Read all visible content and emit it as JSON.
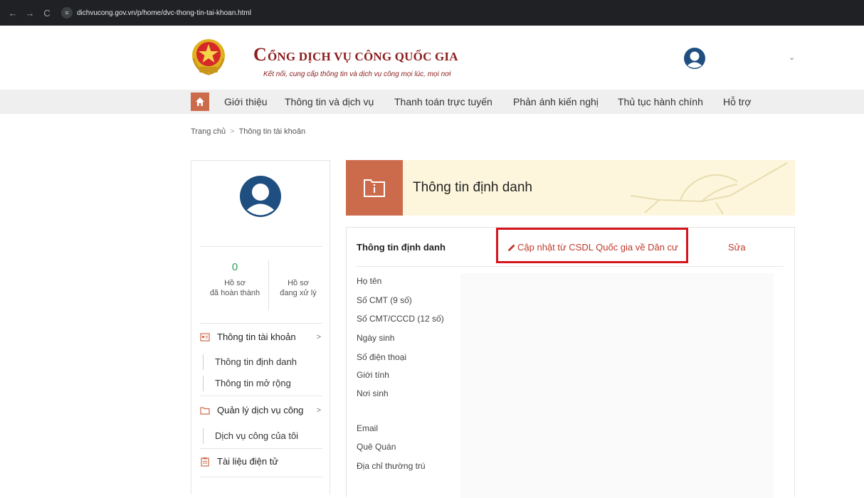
{
  "browser": {
    "back_icon": "←",
    "forward_icon": "→",
    "reload_icon": "C",
    "site_icon": "≡",
    "url": "dichvucong.gov.vn/p/home/dvc-thong-tin-tai-khoan.html"
  },
  "header": {
    "title_first_letter": "C",
    "title_rest": "ỔNG DỊCH VỤ CÔNG QUỐC GIA",
    "subtitle": "Kết nối, cung cấp thông tin và dịch vụ công mọi lúc, mọi nơi",
    "caret": "⌄"
  },
  "menu": {
    "items": [
      "Giới thiệu",
      "Thông tin và dịch vụ",
      "Thanh toán trực tuyến",
      "Phản ánh kiến nghị",
      "Thủ tục hành chính",
      "Hỗ trợ"
    ]
  },
  "breadcrumb": {
    "home": "Trang chủ",
    "separator": ">",
    "current": "Thông tin tài khoản"
  },
  "sidebar": {
    "stats": [
      {
        "value": "0",
        "label_line1": "Hồ sơ",
        "label_line2": "đã hoàn thành"
      },
      {
        "value": "",
        "label_line1": "Hồ sơ",
        "label_line2": "đang xử lý"
      }
    ],
    "groups": [
      {
        "label": "Thông tin tài khoản",
        "chevron": ">",
        "subitems": [
          "Thông tin định danh",
          "Thông tin mở rộng"
        ]
      },
      {
        "label": "Quản lý dịch vụ công",
        "chevron": ">",
        "subitems": [
          "Dịch vụ công của tôi"
        ]
      },
      {
        "label": "Tài liệu điện tử"
      }
    ]
  },
  "banner": {
    "title": "Thông tin định danh"
  },
  "panel": {
    "title": "Thông tin định danh",
    "update_link": "Cập nhật từ CSDL Quốc gia về Dân cư",
    "edit_link": "Sửa",
    "fields": [
      "Họ tên",
      "Số CMT (9 số)",
      "Số CMT/CCCD (12 số)",
      "Ngày sinh",
      "Số điện thoại",
      "Giới tính",
      "Nơi sinh",
      "Email",
      "Quê Quán",
      "Địa chỉ thường trú"
    ]
  },
  "colors": {
    "accent": "#cc6b4c",
    "brand_red": "#8b1c1c",
    "link_red": "#c0392b",
    "highlight_red": "#d6141e",
    "stat_green": "#2e9e55",
    "avatar_blue": "#1f4f80"
  }
}
